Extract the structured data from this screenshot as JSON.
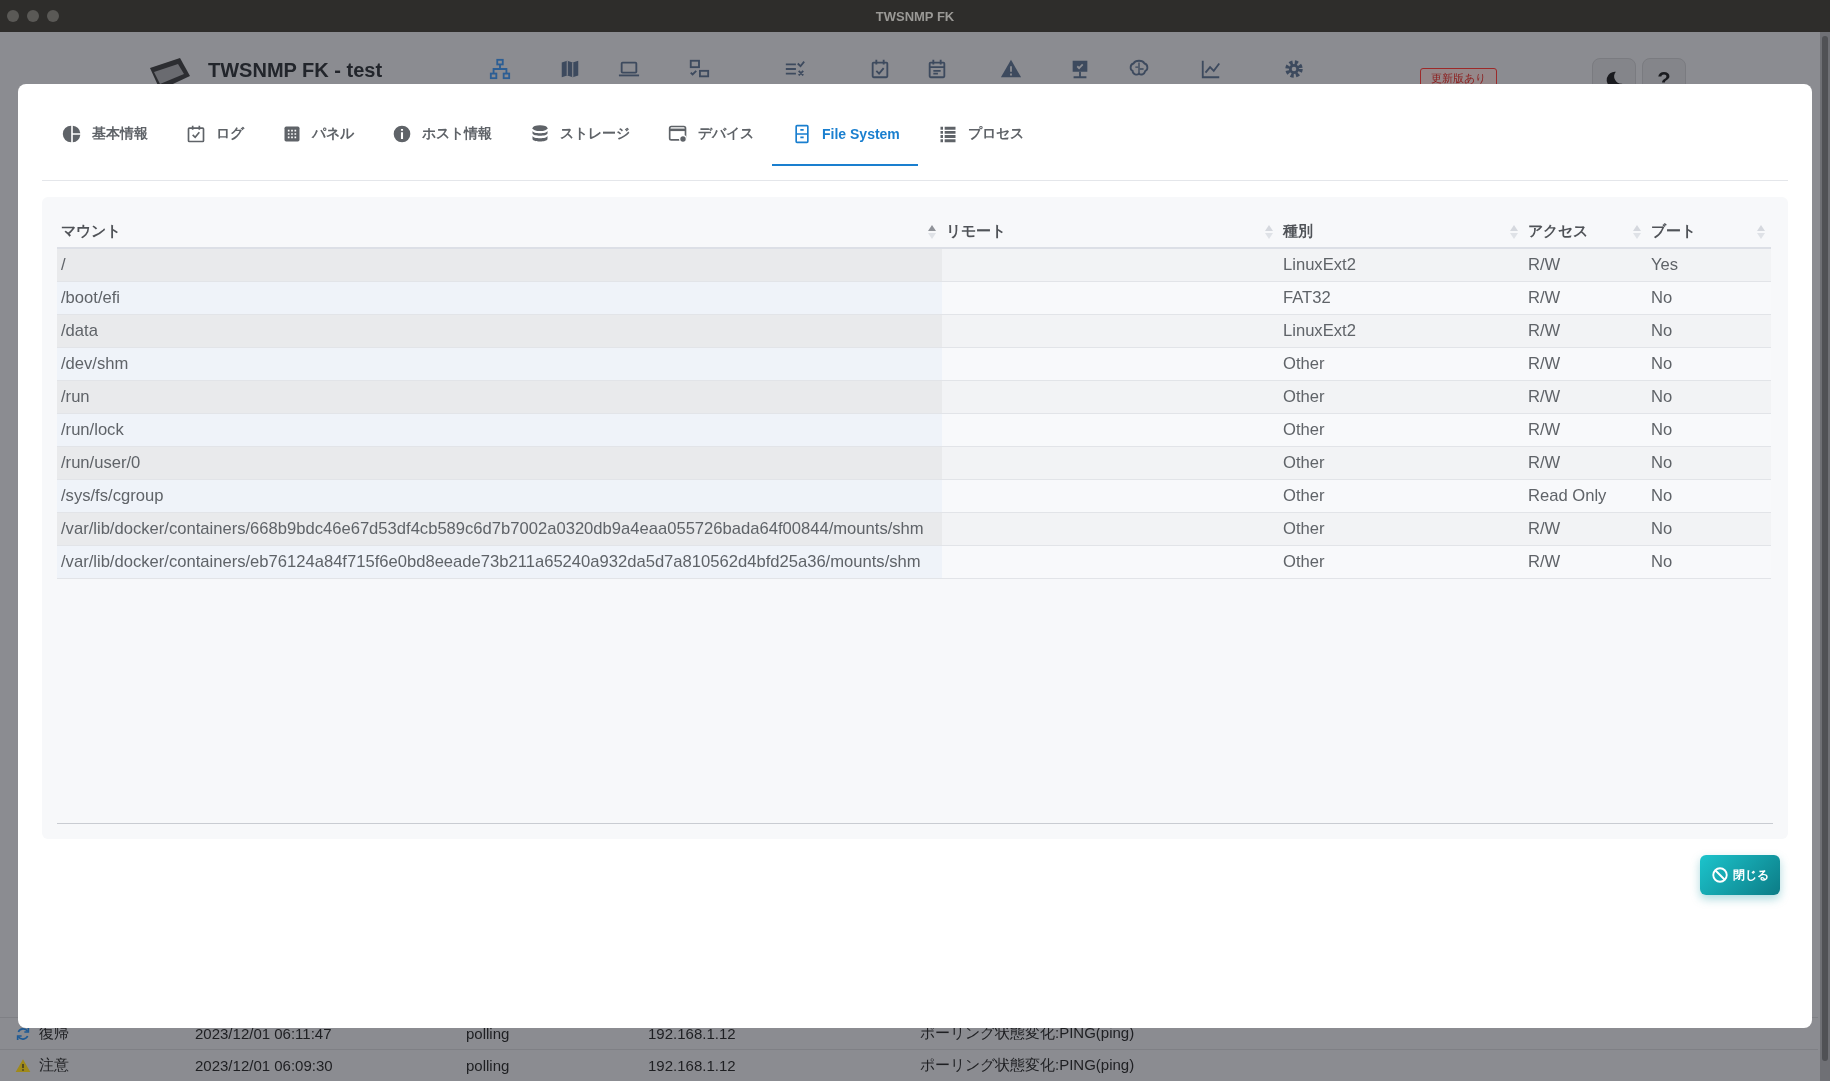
{
  "window": {
    "title": "TWSNMP FK"
  },
  "app_header": {
    "title": "TWSNMP FK - test",
    "update_badge": "更新版あり",
    "help_button": "?"
  },
  "dialog": {
    "tabs": [
      {
        "label": "基本情報",
        "selected": false
      },
      {
        "label": "ログ",
        "selected": false
      },
      {
        "label": "パネル",
        "selected": false
      },
      {
        "label": "ホスト情報",
        "selected": false
      },
      {
        "label": "ストレージ",
        "selected": false
      },
      {
        "label": "デバイス",
        "selected": false
      },
      {
        "label": "File System",
        "selected": true
      },
      {
        "label": "プロセス",
        "selected": false
      }
    ],
    "table": {
      "columns": [
        {
          "label": "マウント",
          "sorted": true
        },
        {
          "label": "リモート",
          "sorted": false
        },
        {
          "label": "種別",
          "sorted": false
        },
        {
          "label": "アクセス",
          "sorted": false
        },
        {
          "label": "ブート",
          "sorted": false
        }
      ],
      "rows": [
        {
          "mount": "/",
          "type": "LinuxExt2",
          "access": "R/W",
          "boot": "Yes"
        },
        {
          "mount": "/boot/efi",
          "type": "FAT32",
          "access": "R/W",
          "boot": "No"
        },
        {
          "mount": "/data",
          "type": "LinuxExt2",
          "access": "R/W",
          "boot": "No"
        },
        {
          "mount": "/dev/shm",
          "type": "Other",
          "access": "R/W",
          "boot": "No"
        },
        {
          "mount": "/run",
          "type": "Other",
          "access": "R/W",
          "boot": "No"
        },
        {
          "mount": "/run/lock",
          "type": "Other",
          "access": "R/W",
          "boot": "No"
        },
        {
          "mount": "/run/user/0",
          "type": "Other",
          "access": "R/W",
          "boot": "No"
        },
        {
          "mount": "/sys/fs/cgroup",
          "type": "Other",
          "access": "Read Only",
          "boot": "No"
        },
        {
          "mount": "/var/lib/docker/containers/668b9bdc46e67d53df4cb589c6d7b7002a0320db9a4eaa055726bada64f00844/mounts/shm",
          "type": "Other",
          "access": "R/W",
          "boot": "No"
        },
        {
          "mount": "/var/lib/docker/containers/eb76124a84f715f6e0bd8eeade73b211a65240a932da5d7a810562d4bfd25a36/mounts/shm",
          "type": "Other",
          "access": "R/W",
          "boot": "No"
        }
      ]
    },
    "close_button": "閉じる"
  },
  "event_log": {
    "rows": [
      {
        "kind": "recovery",
        "level": "復帰",
        "time": "2023/12/01 06:11:47",
        "type": "polling",
        "address": "192.168.1.12",
        "message": "ポーリング状態変化:PING(ping)"
      },
      {
        "kind": "warning",
        "level": "注意",
        "time": "2023/12/01 06:09:30",
        "type": "polling",
        "address": "192.168.1.12",
        "message": "ポーリング状態変化:PING(ping)"
      }
    ]
  }
}
